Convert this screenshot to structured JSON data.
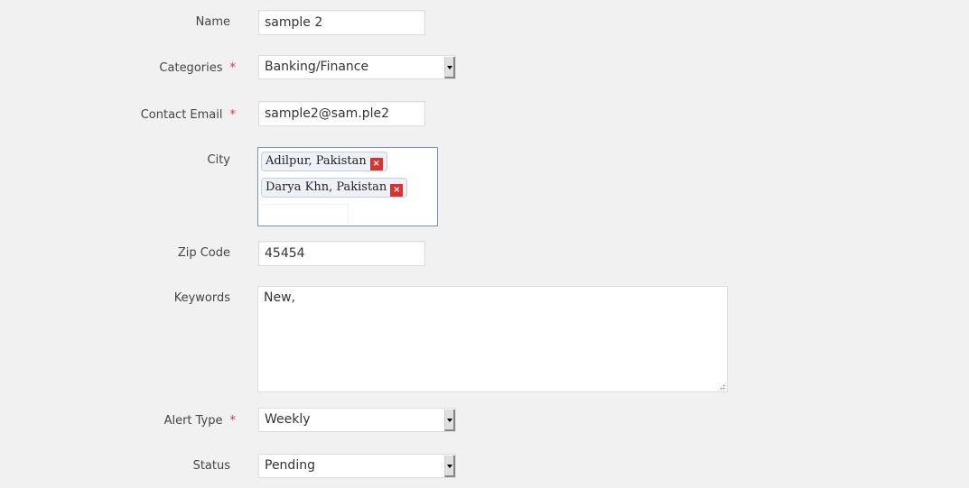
{
  "form": {
    "name": {
      "label": "Name",
      "value": "sample 2"
    },
    "categories": {
      "label": "Categories",
      "required": "*",
      "value": "Banking/Finance"
    },
    "contact_email": {
      "label": "Contact Email",
      "required": "*",
      "value": "sample2@sam.ple2"
    },
    "city": {
      "label": "City",
      "tags": [
        {
          "text": "Adilpur, Pakistan",
          "remove": "×"
        },
        {
          "text": "Darya Khn, Pakistan",
          "remove": "×"
        }
      ],
      "input_value": ""
    },
    "zip_code": {
      "label": "Zip Code",
      "value": "45454"
    },
    "keywords": {
      "label": "Keywords",
      "value": "New,"
    },
    "alert_type": {
      "label": "Alert Type",
      "required": "*",
      "value": "Weekly"
    },
    "status": {
      "label": "Status",
      "value": "Pending"
    }
  },
  "colors": {
    "required": "#dd3333",
    "tag_remove": "#d9322f",
    "city_border": "#7e8fb8"
  }
}
